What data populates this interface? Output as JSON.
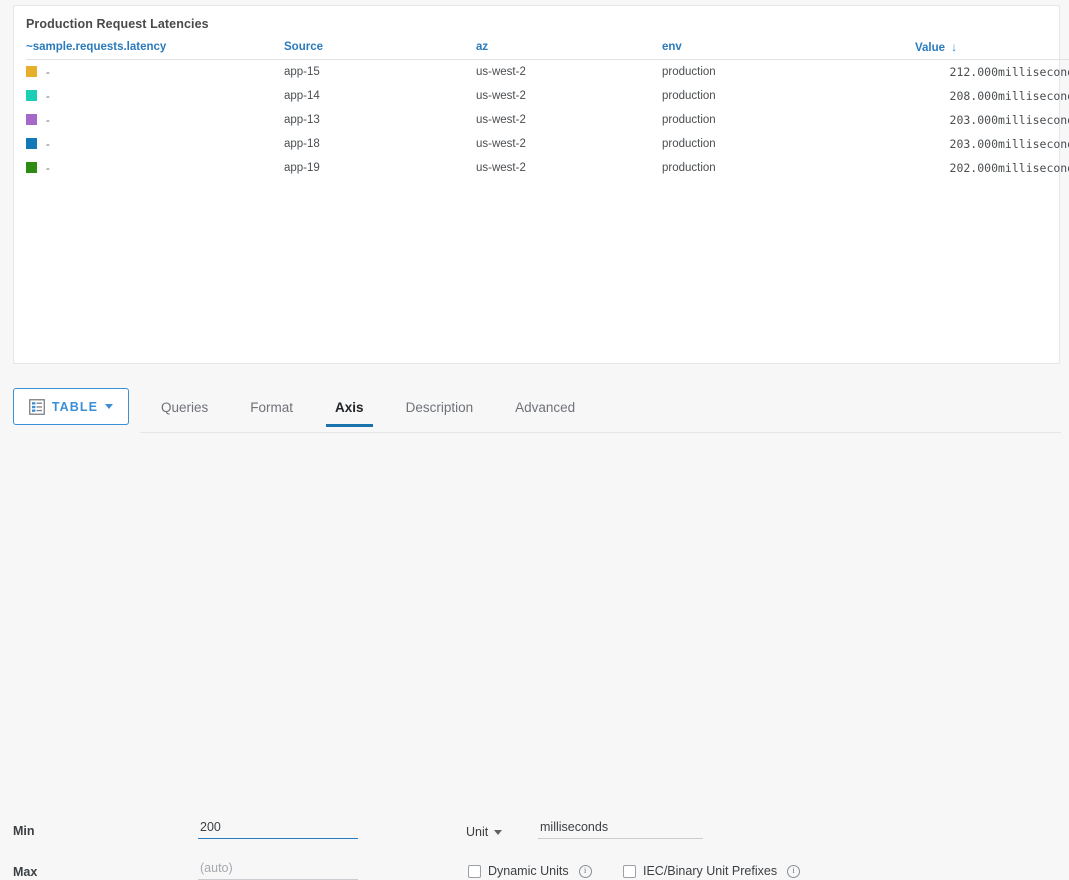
{
  "panel": {
    "title": "Production Request Latencies",
    "columns": {
      "metric": "~sample.requests.latency",
      "source": "Source",
      "az": "az",
      "env": "env",
      "value": "Value",
      "sort_arrow": "↓"
    },
    "rows": [
      {
        "color": "#e8b02a",
        "name": "-",
        "source": "app-15",
        "az": "us-west-2",
        "env": "production",
        "value": "212.000",
        "unit": "milliseconds"
      },
      {
        "color": "#1bcfb4",
        "name": "-",
        "source": "app-14",
        "az": "us-west-2",
        "env": "production",
        "value": "208.000",
        "unit": "milliseconds"
      },
      {
        "color": "#a668c8",
        "name": "-",
        "source": "app-13",
        "az": "us-west-2",
        "env": "production",
        "value": "203.000",
        "unit": "milliseconds"
      },
      {
        "color": "#1278b8",
        "name": "-",
        "source": "app-18",
        "az": "us-west-2",
        "env": "production",
        "value": "203.000",
        "unit": "milliseconds"
      },
      {
        "color": "#2e8b12",
        "name": "-",
        "source": "app-19",
        "az": "us-west-2",
        "env": "production",
        "value": "202.000",
        "unit": "milliseconds"
      }
    ]
  },
  "editor": {
    "chart_type_button": "TABLE",
    "tabs": [
      {
        "label": "Queries",
        "active": false
      },
      {
        "label": "Format",
        "active": false
      },
      {
        "label": "Axis",
        "active": true
      },
      {
        "label": "Description",
        "active": false
      },
      {
        "label": "Advanced",
        "active": false
      }
    ],
    "axis": {
      "min_label": "Min",
      "min_value": "200",
      "min_placeholder": "",
      "max_label": "Max",
      "max_value": "",
      "max_placeholder": "(auto)",
      "unit_label": "Unit",
      "unit_value": "milliseconds",
      "unit_placeholder": "",
      "dynamic_units_label": "Dynamic Units",
      "dynamic_units_checked": false,
      "iec_prefixes_label": "IEC/Binary Unit Prefixes",
      "iec_prefixes_checked": false,
      "info_glyph": "i"
    }
  },
  "chart_data": {
    "type": "table",
    "title": "Production Request Latencies",
    "metric": "~sample.requests.latency",
    "columns": [
      "~sample.requests.latency",
      "Source",
      "az",
      "env",
      "Value"
    ],
    "sorted_by": "Value",
    "sort_direction": "descending",
    "unit": "milliseconds",
    "axis_min": 200,
    "axis_max": null,
    "categories": [
      "app-15",
      "app-14",
      "app-13",
      "app-18",
      "app-19"
    ],
    "values": [
      212.0,
      208.0,
      203.0,
      203.0,
      202.0
    ],
    "series": [
      {
        "name": "~sample.requests.latency",
        "values": [
          212.0,
          208.0,
          203.0,
          203.0,
          202.0
        ]
      }
    ],
    "xlabel": "Source",
    "ylabel": "Value (milliseconds)",
    "legend": [
      "app-15",
      "app-14",
      "app-13",
      "app-18",
      "app-19"
    ],
    "colors": [
      "#e8b02a",
      "#1bcfb4",
      "#a668c8",
      "#1278b8",
      "#2e8b12"
    ]
  }
}
